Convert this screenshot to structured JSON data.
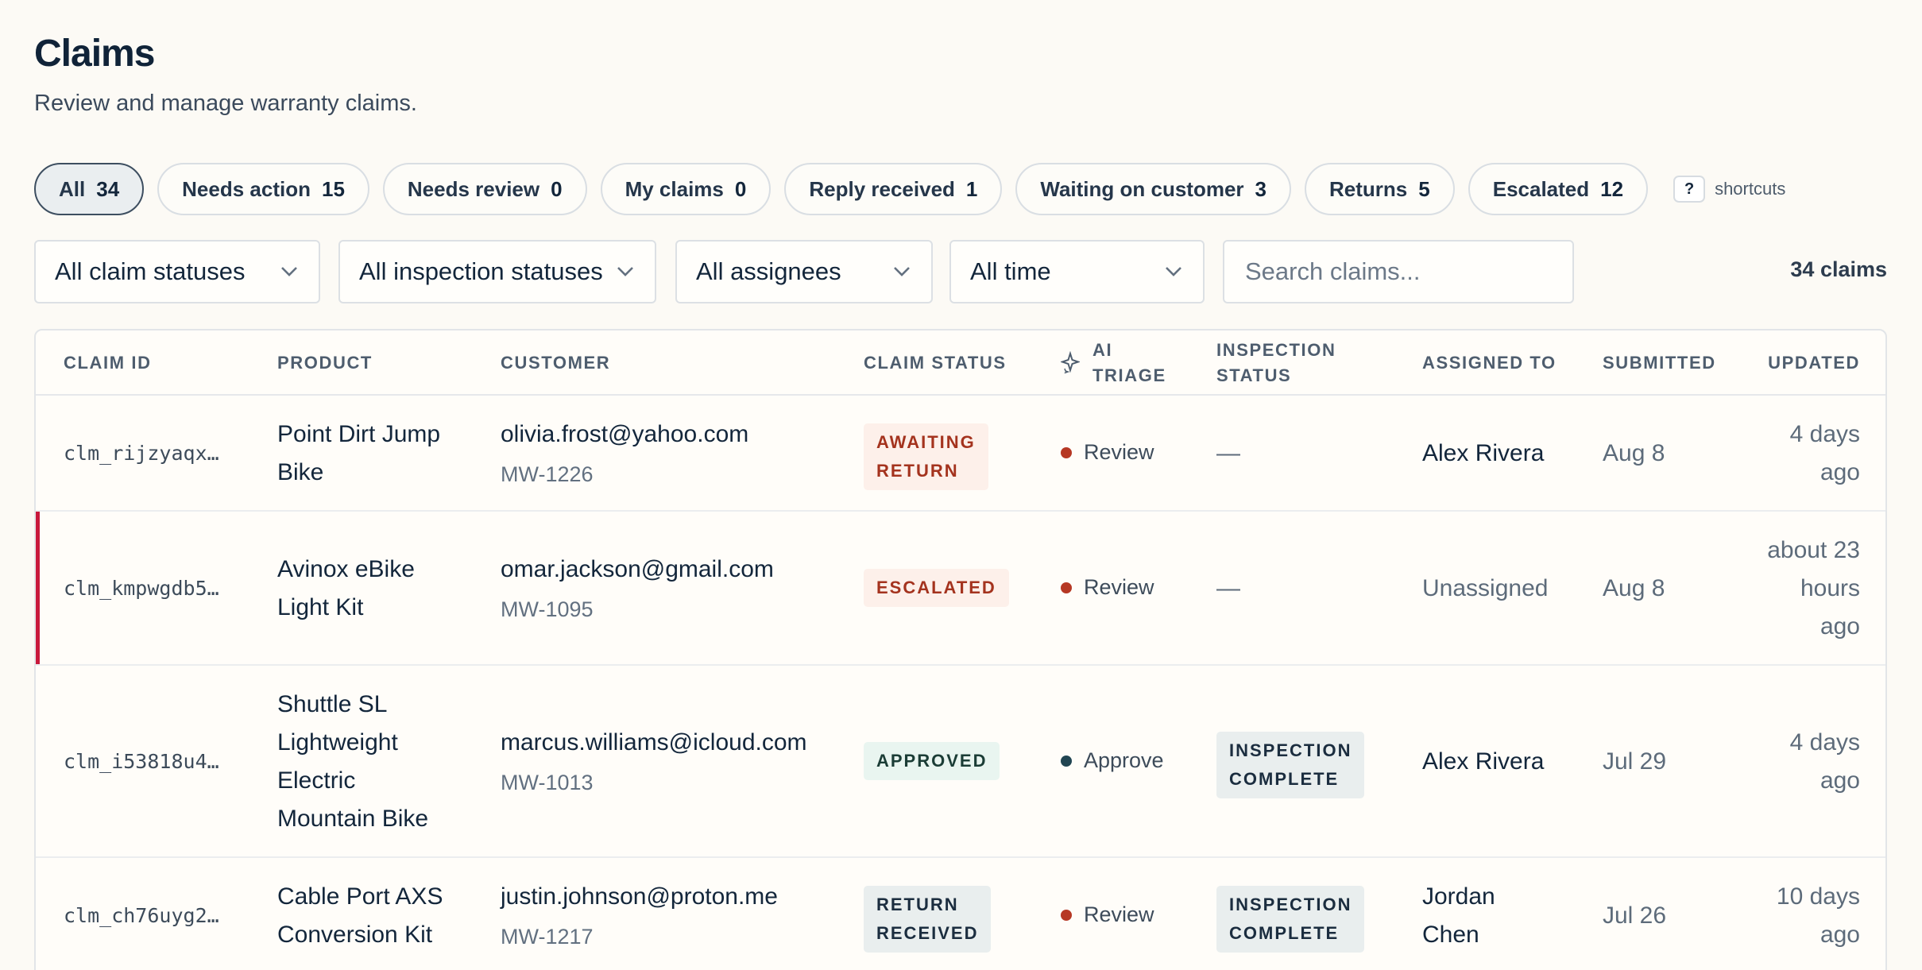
{
  "header": {
    "title": "Claims",
    "subtitle": "Review and manage warranty claims."
  },
  "tabs": [
    {
      "label": "All",
      "count": "34",
      "active": true
    },
    {
      "label": "Needs action",
      "count": "15"
    },
    {
      "label": "Needs review",
      "count": "0"
    },
    {
      "label": "My claims",
      "count": "0"
    },
    {
      "label": "Reply received",
      "count": "1"
    },
    {
      "label": "Waiting on customer",
      "count": "3"
    },
    {
      "label": "Returns",
      "count": "5"
    },
    {
      "label": "Escalated",
      "count": "12"
    }
  ],
  "shortcuts": {
    "key": "?",
    "label": "shortcuts"
  },
  "filters": {
    "claim_status": "All claim statuses",
    "inspection_status": "All inspection statuses",
    "assignees": "All assignees",
    "time": "All time",
    "search_placeholder": "Search claims..."
  },
  "claims_count": "34 claims",
  "table": {
    "headers": {
      "claim_id": "CLAIM ID",
      "product": "PRODUCT",
      "customer": "CUSTOMER",
      "claim_status": "CLAIM STATUS",
      "ai_triage_1": "AI",
      "ai_triage_2": "TRIAGE",
      "inspection_1": "INSPECTION",
      "inspection_2": "STATUS",
      "assigned_to": "ASSIGNED TO",
      "submitted": "SUBMITTED",
      "updated": "UPDATED"
    },
    "rows": [
      {
        "id": "clm_rijzyaqx…",
        "product": [
          "Point Dirt Jump",
          "Bike"
        ],
        "email": "olivia.frost@yahoo.com",
        "order": "MW-1226",
        "status": [
          "AWAITING",
          "RETURN"
        ],
        "triage": "Review",
        "inspection": "—",
        "assignee": "Alex Rivera",
        "submitted": "Aug 8",
        "updated": [
          "4 days",
          "ago"
        ]
      },
      {
        "id": "clm_kmpwgdb5…",
        "product": [
          "Avinox eBike",
          "Light Kit"
        ],
        "email": "omar.jackson@gmail.com",
        "order": "MW-1095",
        "status": [
          "ESCALATED"
        ],
        "triage": "Review",
        "inspection": "—",
        "assignee": "Unassigned",
        "submitted": "Aug 8",
        "updated": [
          "about 23",
          "hours",
          "ago"
        ]
      },
      {
        "id": "clm_i53818u4…",
        "product": [
          "Shuttle SL",
          "Lightweight",
          "Electric",
          "Mountain Bike"
        ],
        "email": "marcus.williams@icloud.com",
        "order": "MW-1013",
        "status": [
          "APPROVED"
        ],
        "triage": "Approve",
        "inspection": [
          "INSPECTION",
          "COMPLETE"
        ],
        "assignee": "Alex Rivera",
        "submitted": "Jul 29",
        "updated": [
          "4 days",
          "ago"
        ]
      },
      {
        "id": "clm_ch76uyg2…",
        "product": [
          "Cable Port AXS",
          "Conversion Kit"
        ],
        "email": "justin.johnson@proton.me",
        "order": "MW-1217",
        "status": [
          "RETURN",
          "RECEIVED"
        ],
        "triage": "Review",
        "inspection": [
          "INSPECTION",
          "COMPLETE"
        ],
        "assignee": [
          "Jordan",
          "Chen"
        ],
        "submitted": "Jul 26",
        "updated": [
          "10 days",
          "ago"
        ]
      }
    ]
  },
  "colors": {
    "background": "#fcfaf5",
    "danger": "#c8193b",
    "review_dot": "#b63824",
    "approve_dot": "#214552"
  }
}
